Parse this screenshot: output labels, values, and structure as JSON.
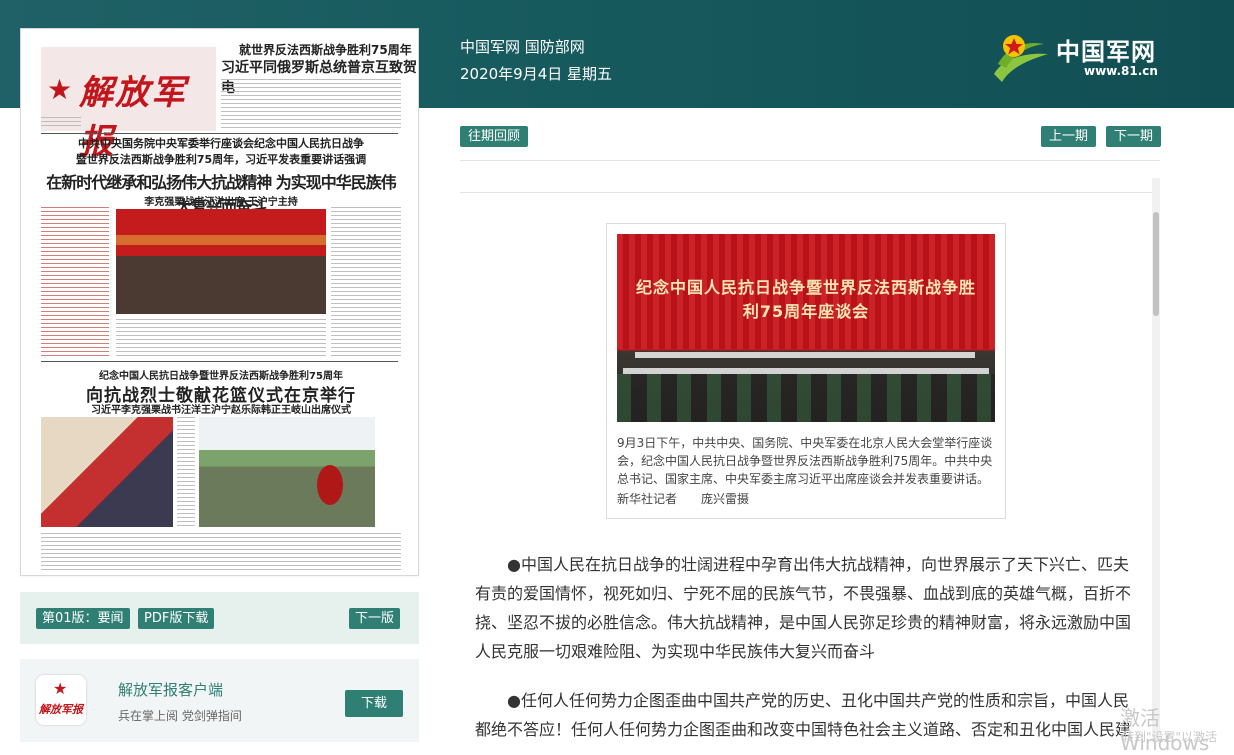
{
  "header": {
    "site_line": "中国军网 国防部网",
    "date_line": "2020年9月4日 星期五",
    "logo_name": "中国军网",
    "logo_url": "www.81.cn"
  },
  "paper_preview": {
    "masthead": "解放军报",
    "top_small": "就世界反法西斯战争胜利75周年",
    "top_headline": "习近平同俄罗斯总统普京互致贺电",
    "lead_kicker_1": "中共中央国务院中央军委举行座谈会纪念中国人民抗日战争",
    "lead_kicker_2": "暨世界反法西斯战争胜利75周年，习近平发表重要讲话强调",
    "lead_headline": "在新时代继承和弘扬伟大抗战精神 为实现中华民族伟大复兴而奋斗",
    "lead_sub": "李克强栗战书汪洋出席 王沪宁主持",
    "second_kicker": "纪念中国人民抗日战争暨世界反法西斯战争胜利75周年",
    "second_headline": "向抗战烈士敬献花篮仪式在京举行",
    "second_sub": "习近平李克强栗战书汪洋王沪宁赵乐际韩正王岐山出席仪式"
  },
  "edition_bar": {
    "edition_label": "第01版：要闻",
    "pdf_label": "PDF版下载",
    "next_edition_label": "下一版"
  },
  "app_promo": {
    "name": "解放军报客户端",
    "desc": "兵在掌上阅 党剑弹指间",
    "download_label": "下载",
    "icon_text": "解放军报"
  },
  "toolbar": {
    "archive_label": "往期回顾",
    "prev_label": "上一期",
    "next_label": "下一期"
  },
  "article": {
    "photo_banner": "纪念中国人民抗日战争暨世界反法西斯战争胜利75周年座谈会",
    "photo_caption": "9月3日下午，中共中央、国务院、中央军委在北京人民大会堂举行座谈会，纪念中国人民抗日战争暨世界反法西斯战争胜利75周年。中共中央总书记、国家主席、中央军委主席习近平出席座谈会并发表重要讲话。",
    "photo_credit": "新华社记者　　庞兴雷摄",
    "paragraph_1": "●中国人民在抗日战争的壮阔进程中孕育出伟大抗战精神，向世界展示了天下兴亡、匹夫有责的爱国情怀，视死如归、宁死不屈的民族气节，不畏强暴、血战到底的英雄气概，百折不挠、坚忍不拔的必胜信念。伟大抗战精神，是中国人民弥足珍贵的精神财富，将永远激励中国人民克服一切艰难险阻、为实现中华民族伟大复兴而奋斗",
    "paragraph_2": "●任何人任何势力企图歪曲中国共产党的历史、丑化中国共产党的性质和宗旨，中国人民都绝不答应！任何人任何势力企图歪曲和改变中国特色社会主义道路、否定和丑化中国人民建"
  },
  "os_overlay": {
    "activate_title": "激活 Windows",
    "activate_hint": "转到\"设置\"以激活"
  },
  "colors": {
    "header_bg": "#1b5c60",
    "accent_teal": "#2f7f74",
    "masthead_red": "#c3161c"
  }
}
